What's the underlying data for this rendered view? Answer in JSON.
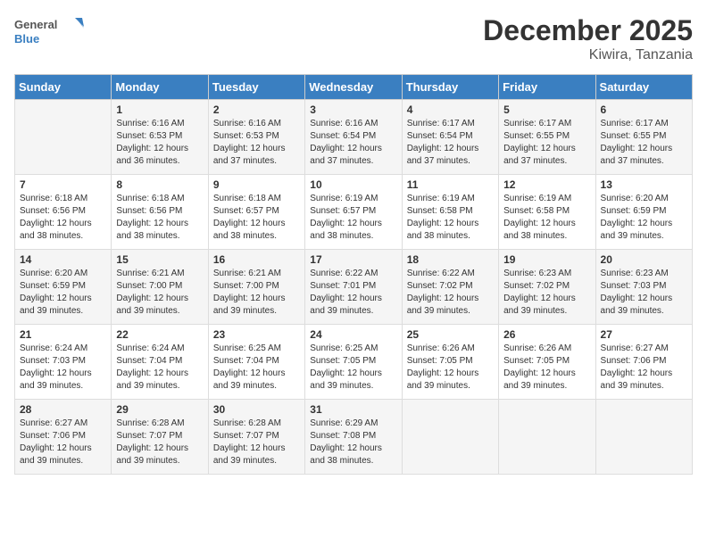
{
  "header": {
    "logo_general": "General",
    "logo_blue": "Blue",
    "month_title": "December 2025",
    "location": "Kiwira, Tanzania"
  },
  "days_of_week": [
    "Sunday",
    "Monday",
    "Tuesday",
    "Wednesday",
    "Thursday",
    "Friday",
    "Saturday"
  ],
  "weeks": [
    [
      {
        "day": "",
        "content": ""
      },
      {
        "day": "1",
        "content": "Sunrise: 6:16 AM\nSunset: 6:53 PM\nDaylight: 12 hours\nand 36 minutes."
      },
      {
        "day": "2",
        "content": "Sunrise: 6:16 AM\nSunset: 6:53 PM\nDaylight: 12 hours\nand 37 minutes."
      },
      {
        "day": "3",
        "content": "Sunrise: 6:16 AM\nSunset: 6:54 PM\nDaylight: 12 hours\nand 37 minutes."
      },
      {
        "day": "4",
        "content": "Sunrise: 6:17 AM\nSunset: 6:54 PM\nDaylight: 12 hours\nand 37 minutes."
      },
      {
        "day": "5",
        "content": "Sunrise: 6:17 AM\nSunset: 6:55 PM\nDaylight: 12 hours\nand 37 minutes."
      },
      {
        "day": "6",
        "content": "Sunrise: 6:17 AM\nSunset: 6:55 PM\nDaylight: 12 hours\nand 37 minutes."
      }
    ],
    [
      {
        "day": "7",
        "content": "Sunrise: 6:18 AM\nSunset: 6:56 PM\nDaylight: 12 hours\nand 38 minutes."
      },
      {
        "day": "8",
        "content": "Sunrise: 6:18 AM\nSunset: 6:56 PM\nDaylight: 12 hours\nand 38 minutes."
      },
      {
        "day": "9",
        "content": "Sunrise: 6:18 AM\nSunset: 6:57 PM\nDaylight: 12 hours\nand 38 minutes."
      },
      {
        "day": "10",
        "content": "Sunrise: 6:19 AM\nSunset: 6:57 PM\nDaylight: 12 hours\nand 38 minutes."
      },
      {
        "day": "11",
        "content": "Sunrise: 6:19 AM\nSunset: 6:58 PM\nDaylight: 12 hours\nand 38 minutes."
      },
      {
        "day": "12",
        "content": "Sunrise: 6:19 AM\nSunset: 6:58 PM\nDaylight: 12 hours\nand 38 minutes."
      },
      {
        "day": "13",
        "content": "Sunrise: 6:20 AM\nSunset: 6:59 PM\nDaylight: 12 hours\nand 39 minutes."
      }
    ],
    [
      {
        "day": "14",
        "content": "Sunrise: 6:20 AM\nSunset: 6:59 PM\nDaylight: 12 hours\nand 39 minutes."
      },
      {
        "day": "15",
        "content": "Sunrise: 6:21 AM\nSunset: 7:00 PM\nDaylight: 12 hours\nand 39 minutes."
      },
      {
        "day": "16",
        "content": "Sunrise: 6:21 AM\nSunset: 7:00 PM\nDaylight: 12 hours\nand 39 minutes."
      },
      {
        "day": "17",
        "content": "Sunrise: 6:22 AM\nSunset: 7:01 PM\nDaylight: 12 hours\nand 39 minutes."
      },
      {
        "day": "18",
        "content": "Sunrise: 6:22 AM\nSunset: 7:02 PM\nDaylight: 12 hours\nand 39 minutes."
      },
      {
        "day": "19",
        "content": "Sunrise: 6:23 AM\nSunset: 7:02 PM\nDaylight: 12 hours\nand 39 minutes."
      },
      {
        "day": "20",
        "content": "Sunrise: 6:23 AM\nSunset: 7:03 PM\nDaylight: 12 hours\nand 39 minutes."
      }
    ],
    [
      {
        "day": "21",
        "content": "Sunrise: 6:24 AM\nSunset: 7:03 PM\nDaylight: 12 hours\nand 39 minutes."
      },
      {
        "day": "22",
        "content": "Sunrise: 6:24 AM\nSunset: 7:04 PM\nDaylight: 12 hours\nand 39 minutes."
      },
      {
        "day": "23",
        "content": "Sunrise: 6:25 AM\nSunset: 7:04 PM\nDaylight: 12 hours\nand 39 minutes."
      },
      {
        "day": "24",
        "content": "Sunrise: 6:25 AM\nSunset: 7:05 PM\nDaylight: 12 hours\nand 39 minutes."
      },
      {
        "day": "25",
        "content": "Sunrise: 6:26 AM\nSunset: 7:05 PM\nDaylight: 12 hours\nand 39 minutes."
      },
      {
        "day": "26",
        "content": "Sunrise: 6:26 AM\nSunset: 7:05 PM\nDaylight: 12 hours\nand 39 minutes."
      },
      {
        "day": "27",
        "content": "Sunrise: 6:27 AM\nSunset: 7:06 PM\nDaylight: 12 hours\nand 39 minutes."
      }
    ],
    [
      {
        "day": "28",
        "content": "Sunrise: 6:27 AM\nSunset: 7:06 PM\nDaylight: 12 hours\nand 39 minutes."
      },
      {
        "day": "29",
        "content": "Sunrise: 6:28 AM\nSunset: 7:07 PM\nDaylight: 12 hours\nand 39 minutes."
      },
      {
        "day": "30",
        "content": "Sunrise: 6:28 AM\nSunset: 7:07 PM\nDaylight: 12 hours\nand 39 minutes."
      },
      {
        "day": "31",
        "content": "Sunrise: 6:29 AM\nSunset: 7:08 PM\nDaylight: 12 hours\nand 38 minutes."
      },
      {
        "day": "",
        "content": ""
      },
      {
        "day": "",
        "content": ""
      },
      {
        "day": "",
        "content": ""
      }
    ]
  ]
}
